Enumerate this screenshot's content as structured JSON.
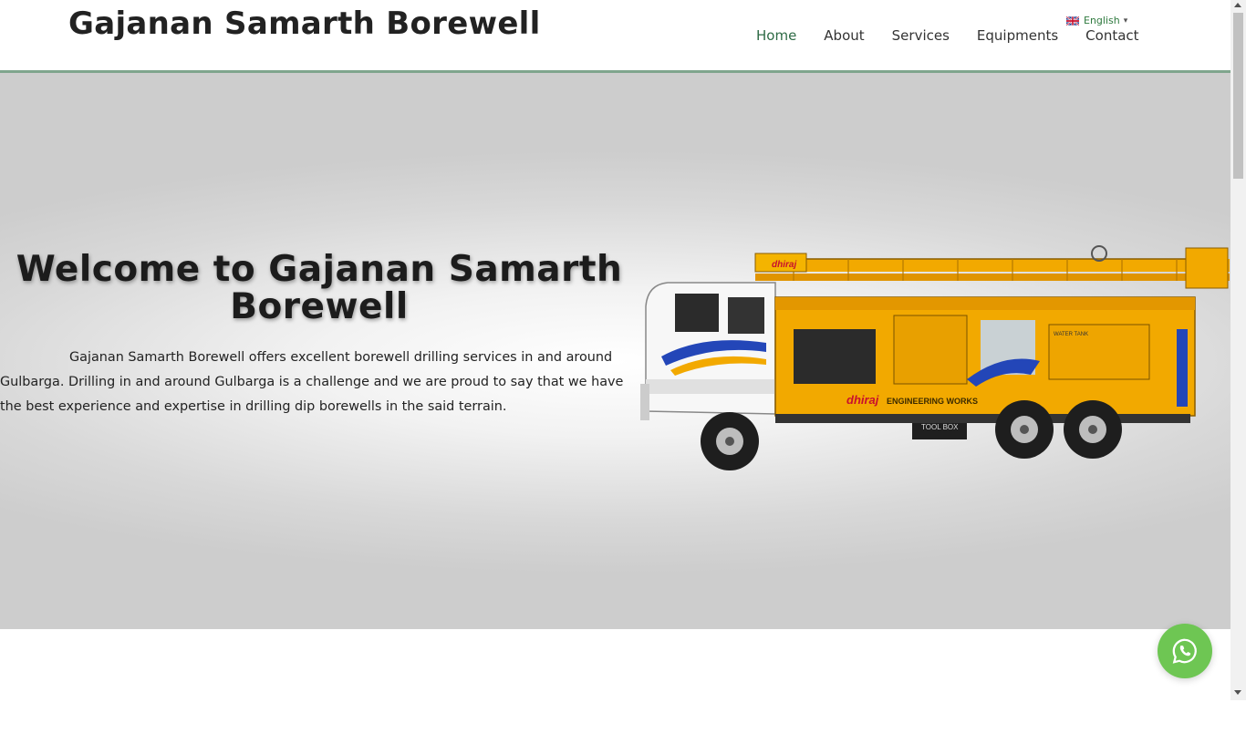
{
  "site": {
    "logo": "Gajanan Samarth Borewell"
  },
  "nav": {
    "items": [
      "Home",
      "About",
      "Services",
      "Equipments",
      "Contact"
    ],
    "active": "Home"
  },
  "language": {
    "label": "English",
    "icon": "uk-flag-icon",
    "caret": "▾"
  },
  "hero": {
    "title": "Welcome to Gajanan Samarth Borewell",
    "text": "Gajanan Samarth Borewell offers excellent borewell drilling services in and around Gulbarga. Drilling in and around Gulbarga is a challenge and we are proud to say that we have the best experience and expertise in drilling dip borewells in the said terrain.",
    "image": "borewell-drilling-truck",
    "truck_text": {
      "brand": "dhiraj",
      "company": "ENGINEERING WORKS",
      "tool_box": "TOOL BOX",
      "water_tank": "WATER TANK"
    }
  },
  "floating": {
    "whatsapp_icon": "whatsapp-icon"
  },
  "colors": {
    "accent_green": "#2e6b45",
    "header_border": "#7fa58d",
    "whatsapp": "#6ec653",
    "truck_yellow": "#f2a900"
  }
}
